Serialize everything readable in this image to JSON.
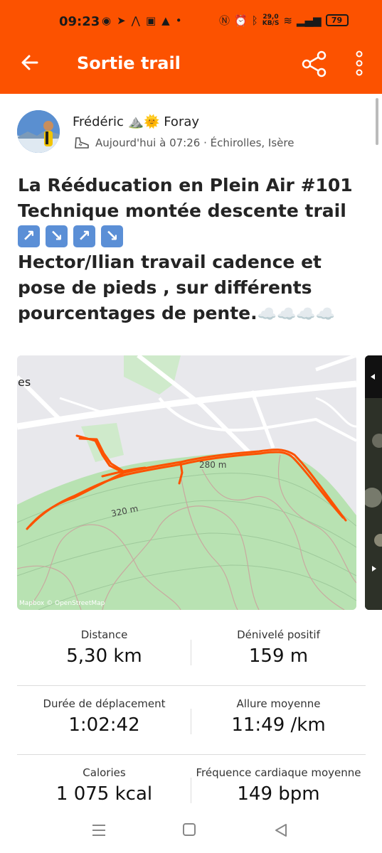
{
  "status_bar": {
    "time": "09:23",
    "net_speed_value": "29,0",
    "net_speed_unit": "KB/S",
    "battery": "79"
  },
  "app_bar": {
    "title": "Sortie trail",
    "back_icon": "arrow-left-icon",
    "share_icon": "share-icon",
    "more_icon": "more-vertical-icon",
    "background": "#fc5200"
  },
  "activity": {
    "athlete_first": "Frédéric",
    "athlete_emoji": "⛰️🌞",
    "athlete_last": "Foray",
    "meta": "Aujourd'hui à 07:26 · Échirolles, Isère",
    "sport_icon": "running-shoe-icon",
    "title_lines": [
      "La Rééducation en Plein Air #101",
      "Technique montée descente trail"
    ],
    "arrows": [
      "↗",
      "↘",
      "↗",
      "↘"
    ],
    "desc_lines": [
      "Hector/Ilian  travail cadence et",
      "pose de pieds , sur différents",
      "pourcentages de pente."
    ],
    "clouds": "☁️☁️☁️☁️"
  },
  "map": {
    "attribution": "Mapbox © OpenStreetMap",
    "label_280": "280 m",
    "label_320": "320 m",
    "label_es": "es",
    "route_color": "#fc5200",
    "terrain_color": "#b8e2b2"
  },
  "stats": [
    {
      "left_label": "Distance",
      "left_value": "5,30 km",
      "right_label": "Dénivelé positif",
      "right_value": "159 m"
    },
    {
      "left_label": "Durée de déplacement",
      "left_value": "1:02:42",
      "right_label": "Allure moyenne",
      "right_value": "11:49 /km"
    },
    {
      "left_label": "Calories",
      "left_value": "1 075 kcal",
      "right_label": "Fréquence cardiaque moyenne",
      "right_value": "149 bpm"
    }
  ]
}
